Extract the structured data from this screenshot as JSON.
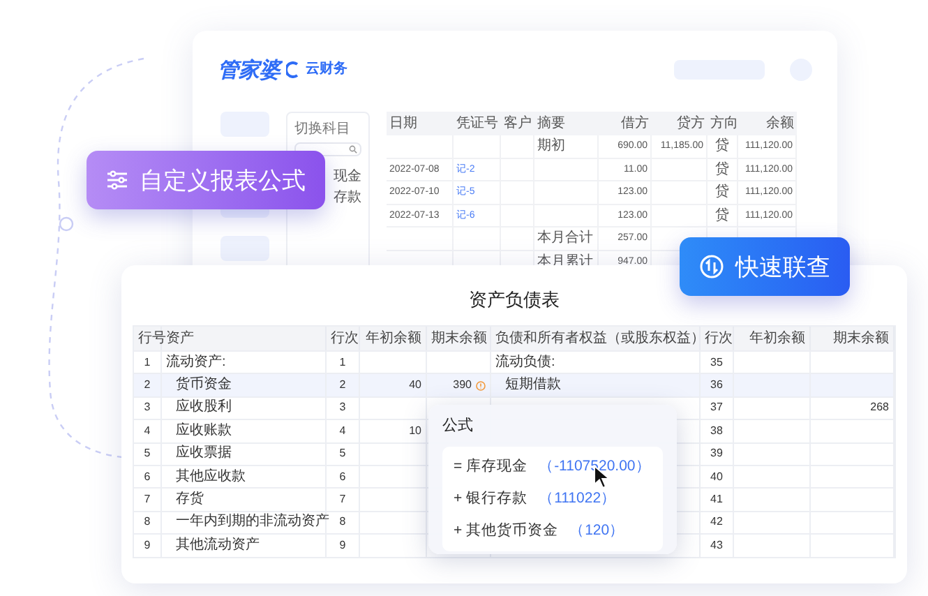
{
  "back_window": {
    "logo": {
      "brand": "管家婆",
      "product": "云财务"
    },
    "subject_panel": {
      "title": "切换科目",
      "items": [
        "现金",
        "存款"
      ]
    },
    "ledger": {
      "columns": [
        "日期",
        "凭证号",
        "客户",
        "摘要",
        "借方",
        "贷方",
        "方向",
        "余额"
      ],
      "rows": [
        {
          "summary": "期初",
          "debit": "690.00",
          "credit": "11,185.00",
          "direction": "贷",
          "balance": "111,120.00"
        },
        {
          "date": "2022-07-08",
          "voucher": "记-2",
          "debit": "11.00",
          "direction": "贷",
          "balance": "111,120.00"
        },
        {
          "date": "2022-07-10",
          "voucher": "记-5",
          "debit": "123.00",
          "direction": "贷",
          "balance": "111,120.00"
        },
        {
          "date": "2022-07-13",
          "voucher": "记-6",
          "debit": "123.00",
          "direction": "贷",
          "balance": "111,120.00"
        },
        {
          "summary": "本月合计",
          "debit": "257.00"
        },
        {
          "summary": "本月累计",
          "debit": "947.00"
        }
      ]
    }
  },
  "badges": [
    {
      "kind": "formula",
      "text": "自定义报表公式"
    },
    {
      "kind": "link",
      "text": "快速联查"
    }
  ],
  "report": {
    "title": "资产负债表",
    "columns": [
      "行号",
      "资产",
      "行次",
      "年初余额",
      "期末余额",
      "负债和所有者权益（或股东权益）",
      "行次",
      "年初余额",
      "期末余额"
    ],
    "rows": [
      {
        "selected": false,
        "warning": false,
        "no": "1",
        "asset": "流动资产:",
        "line": "1",
        "liability": "流动负债:",
        "line2": "35"
      },
      {
        "selected": true,
        "warning": true,
        "no": "2",
        "asset": "货币资金",
        "line": "2",
        "begin": "40",
        "end": "390",
        "liability": "短期借款",
        "line2": "36"
      },
      {
        "selected": false,
        "warning": false,
        "no": "3",
        "asset": "应收股利",
        "line": "3",
        "line2": "37",
        "end2": "268"
      },
      {
        "selected": false,
        "warning": false,
        "no": "4",
        "asset": "应收账款",
        "line": "4",
        "begin": "10",
        "line2": "38"
      },
      {
        "selected": false,
        "warning": false,
        "no": "5",
        "asset": "应收票据",
        "line": "5",
        "line2": "39"
      },
      {
        "selected": false,
        "warning": false,
        "no": "6",
        "asset": "其他应收款",
        "line": "6",
        "line2": "40"
      },
      {
        "selected": false,
        "warning": false,
        "no": "7",
        "asset": "存货",
        "line": "7",
        "line2": "41"
      },
      {
        "selected": false,
        "warning": false,
        "no": "8",
        "asset": "一年内到期的非流动资产",
        "line": "8",
        "line2": "42"
      },
      {
        "selected": false,
        "warning": false,
        "no": "9",
        "asset": "其他流动资产",
        "line": "9",
        "line2": "43"
      }
    ]
  },
  "formula_popup": {
    "title": "公式",
    "lines": [
      {
        "term": "= 库存现金",
        "value": "（-1107520.00）"
      },
      {
        "term": "+ 银行存款",
        "value": "（111022）"
      },
      {
        "term": "+ 其他货币资金",
        "value": "（120）"
      }
    ]
  }
}
